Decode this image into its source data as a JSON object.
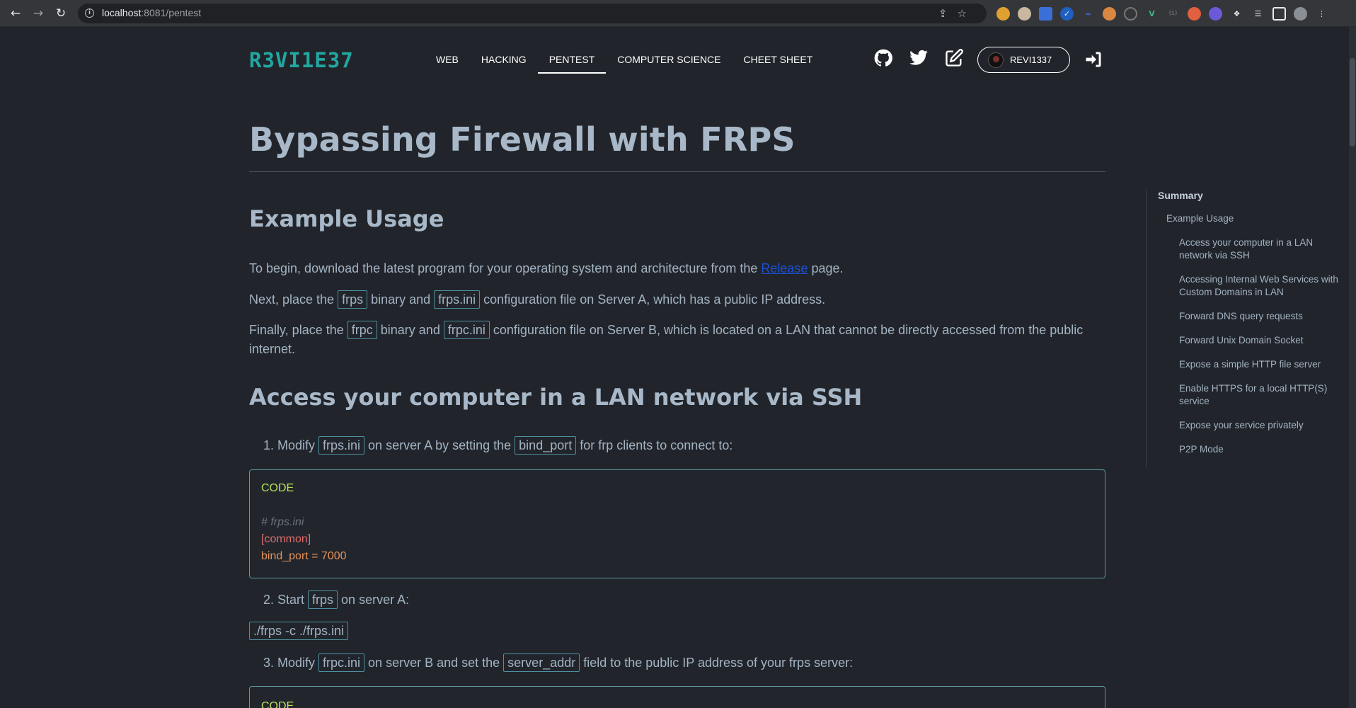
{
  "browser": {
    "url_host": "localhost",
    "url_rest": ":8081/pentest"
  },
  "site": {
    "brand": "R3VI1E37",
    "nav": [
      "WEB",
      "HACKING",
      "PENTEST",
      "COMPUTER SCIENCE",
      "CHEET SHEET"
    ],
    "active_nav": "PENTEST",
    "user": "REVI1337"
  },
  "article": {
    "title": "Bypassing Firewall with FRPS",
    "section1": "Example Usage",
    "p1_before": "To begin, download the latest program for your operating system and architecture from the ",
    "p1_link": "Release",
    "p1_after": " page.",
    "p2_a": "Next, place the ",
    "p2_code1": "frps",
    "p2_b": " binary and ",
    "p2_code2": "frps.ini",
    "p2_c": " configuration file on Server A, which has a public IP address.",
    "p3_a": "Finally, place the ",
    "p3_code1": "frpc",
    "p3_b": " binary and ",
    "p3_code2": "frpc.ini",
    "p3_c": " configuration file on Server B, which is located on a LAN that cannot be directly accessed from the public internet.",
    "section2": "Access your computer in a LAN network via SSH",
    "step1_a": "1. Modify ",
    "step1_code1": "frps.ini",
    "step1_b": " on server A by setting the ",
    "step1_code2": "bind_port",
    "step1_c": " for frp clients to connect to:",
    "code1": {
      "label": "CODE",
      "comment": "# frps.ini",
      "section": "[common]",
      "kv": "bind_port = 7000"
    },
    "step2_a": "2. Start ",
    "step2_code": "frps",
    "step2_b": " on server A:",
    "cmd": "./frps -c ./frps.ini",
    "step3_a": "3. Modify ",
    "step3_code1": "frpc.ini",
    "step3_b": " on server B and set the ",
    "step3_code2": "server_addr",
    "step3_c": " field to the public IP address of your frps server:",
    "code2_label": "CODE"
  },
  "toc": {
    "title": "Summary",
    "items": [
      {
        "label": "Example Usage",
        "level": 1
      },
      {
        "label": "Access your computer in a LAN network via SSH",
        "level": 2
      },
      {
        "label": "Accessing Internal Web Services with Custom Domains in LAN",
        "level": 2
      },
      {
        "label": "Forward DNS query requests",
        "level": 2
      },
      {
        "label": "Forward Unix Domain Socket",
        "level": 2
      },
      {
        "label": "Expose a simple HTTP file server",
        "level": 2
      },
      {
        "label": "Enable HTTPS for a local HTTP(S) service",
        "level": 2
      },
      {
        "label": "Expose your service privately",
        "level": 2
      },
      {
        "label": "P2P Mode",
        "level": 2
      }
    ]
  },
  "icons": {
    "github": "github-icon",
    "twitter": "twitter-icon",
    "edit": "edit-icon",
    "login": "login-icon"
  },
  "colors": {
    "brand": "#22a7a0",
    "background": "#21252b",
    "link": "#1a4fd6",
    "code_border": "#5f95a5"
  }
}
